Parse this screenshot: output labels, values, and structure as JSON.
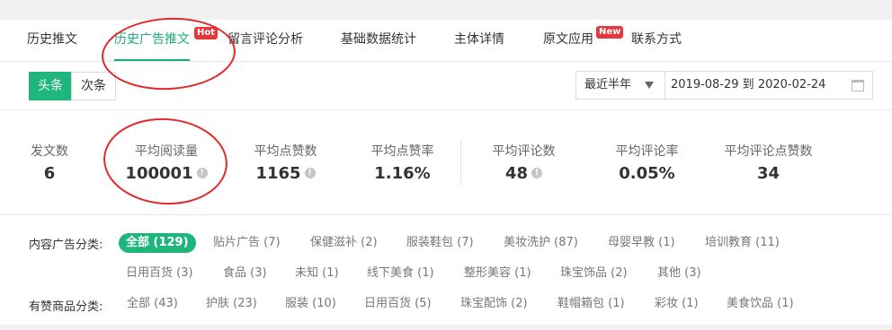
{
  "tabs": [
    {
      "label": "历史推文",
      "active": false
    },
    {
      "label": "历史广告推文",
      "active": true,
      "badge": "Hot"
    },
    {
      "label": "留言评论分析",
      "active": false
    },
    {
      "label": "基础数据统计",
      "active": false
    },
    {
      "label": "主体详情",
      "active": false
    },
    {
      "label": "原文应用",
      "active": false,
      "badge": "New"
    },
    {
      "label": "联系方式",
      "active": false
    }
  ],
  "position_toggle": {
    "primary": "头条",
    "secondary": "次条",
    "selected": "头条"
  },
  "date_filter": {
    "range_select": "最近半年",
    "date_range": "2019-08-29 到 2020-02-24"
  },
  "stats": [
    {
      "label": "发文数",
      "value": "6",
      "info": false
    },
    {
      "label": "平均阅读量",
      "value": "100001",
      "info": true
    },
    {
      "label": "平均点赞数",
      "value": "1165",
      "info": true
    },
    {
      "label": "平均点赞率",
      "value": "1.16%",
      "info": false
    },
    {
      "label": "平均评论数",
      "value": "48",
      "info": true
    },
    {
      "label": "平均评论率",
      "value": "0.05%",
      "info": false
    },
    {
      "label": "平均评论点赞数",
      "value": "34",
      "info": false
    }
  ],
  "content_ad_category": {
    "label": "内容广告分类:",
    "row1": [
      "全部 (129)",
      "贴片广告 (7)",
      "保健滋补 (2)",
      "服装鞋包 (7)",
      "美妆洗护 (87)",
      "母婴早教 (1)",
      "培训教育 (11)"
    ],
    "row2": [
      "日用百货 (3)",
      "食品 (3)",
      "未知 (1)",
      "线下美食 (1)",
      "整形美容 (1)",
      "珠宝饰品 (2)",
      "其他 (3)"
    ],
    "selected": "全部 (129)"
  },
  "sponsored_goods_category": {
    "label": "有赞商品分类:",
    "items": [
      "全部 (43)",
      "护肤 (23)",
      "服装 (10)",
      "日用百货 (5)",
      "珠宝配饰 (2)",
      "鞋帽箱包 (1)",
      "彩妆 (1)",
      "美食饮品 (1)"
    ]
  },
  "colors": {
    "accent": "#1fb67d",
    "badge": "#e5373c",
    "annotation": "#e02a2a"
  }
}
